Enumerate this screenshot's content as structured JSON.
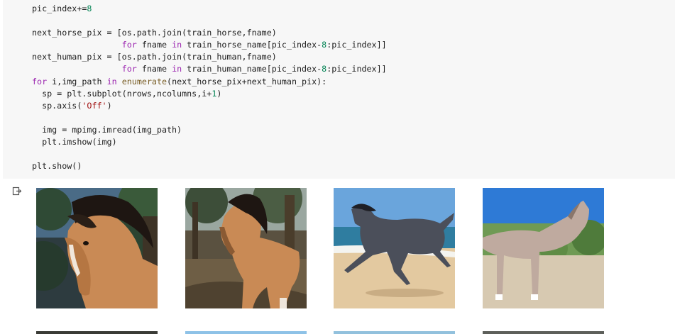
{
  "code": {
    "lines": [
      [
        {
          "t": "pic_index+=",
          "c": ""
        },
        {
          "t": "8",
          "c": "num"
        }
      ],
      [
        {
          "t": "",
          "c": ""
        }
      ],
      [
        {
          "t": "next_horse_pix = [os.path.join(train_horse,fname)",
          "c": ""
        }
      ],
      [
        {
          "t": "                  ",
          "c": ""
        },
        {
          "t": "for",
          "c": "kw"
        },
        {
          "t": " fname ",
          "c": ""
        },
        {
          "t": "in",
          "c": "kw"
        },
        {
          "t": " train_horse_name[pic_index-",
          "c": ""
        },
        {
          "t": "8",
          "c": "num"
        },
        {
          "t": ":pic_index]]",
          "c": ""
        }
      ],
      [
        {
          "t": "next_human_pix = [os.path.join(train_human,fname)",
          "c": ""
        }
      ],
      [
        {
          "t": "                  ",
          "c": ""
        },
        {
          "t": "for",
          "c": "kw"
        },
        {
          "t": " fname ",
          "c": ""
        },
        {
          "t": "in",
          "c": "kw"
        },
        {
          "t": " train_human_name[pic_index-",
          "c": ""
        },
        {
          "t": "8",
          "c": "num"
        },
        {
          "t": ":pic_index]]",
          "c": ""
        }
      ],
      [
        {
          "t": "for",
          "c": "kw"
        },
        {
          "t": " i,img_path ",
          "c": ""
        },
        {
          "t": "in",
          "c": "kw"
        },
        {
          "t": " ",
          "c": ""
        },
        {
          "t": "enumerate",
          "c": "fn"
        },
        {
          "t": "(next_horse_pix+next_human_pix):",
          "c": ""
        }
      ],
      [
        {
          "t": "  sp = plt.subplot(nrows,ncolumns,i+",
          "c": ""
        },
        {
          "t": "1",
          "c": "num"
        },
        {
          "t": ")",
          "c": ""
        }
      ],
      [
        {
          "t": "  sp.axis(",
          "c": ""
        },
        {
          "t": "'Off'",
          "c": "str"
        },
        {
          "t": ")",
          "c": ""
        }
      ],
      [
        {
          "t": "",
          "c": ""
        }
      ],
      [
        {
          "t": "  img = mpimg.imread(img_path)",
          "c": ""
        }
      ],
      [
        {
          "t": "  plt.imshow(img)",
          "c": ""
        }
      ],
      [
        {
          "t": "",
          "c": ""
        }
      ],
      [
        {
          "t": "plt.show()",
          "c": ""
        }
      ]
    ]
  },
  "output": {
    "icon": "output-icon",
    "images": [
      {
        "name": "horse-image-1",
        "subject": "brown horse close-up in forest"
      },
      {
        "name": "horse-image-2",
        "subject": "brown horse walking in forest"
      },
      {
        "name": "horse-image-3",
        "subject": "dark grey horse galloping on beach"
      },
      {
        "name": "horse-image-4",
        "subject": "dappled grey horse standing on sand"
      }
    ]
  }
}
